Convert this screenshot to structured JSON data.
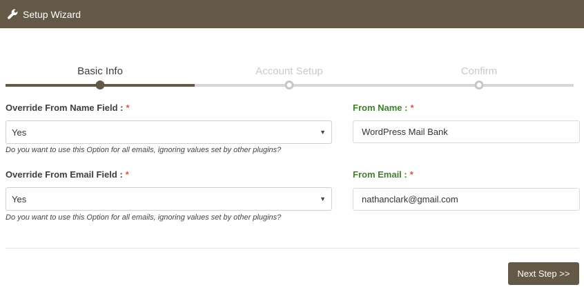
{
  "header": {
    "title": "Setup Wizard",
    "icon": "wrench-icon"
  },
  "wizard": {
    "steps": [
      {
        "label": "Basic Info",
        "state": "active"
      },
      {
        "label": "Account Setup",
        "state": "inactive"
      },
      {
        "label": "Confirm",
        "state": "inactive"
      }
    ]
  },
  "form": {
    "override_name": {
      "label": "Override From Name Field :",
      "required_mark": "*",
      "value": "Yes",
      "help": "Do you want to use this Option for all emails, ignoring values set by other plugins?"
    },
    "from_name": {
      "label": "From Name :",
      "required_mark": "*",
      "value": "WordPress Mail Bank"
    },
    "override_email": {
      "label": "Override From Email Field :",
      "required_mark": "*",
      "value": "Yes",
      "help": "Do you want to use this Option for all emails, ignoring values set by other plugins?"
    },
    "from_email": {
      "label": "From Email :",
      "required_mark": "*",
      "value": "nathanclark@gmail.com"
    }
  },
  "footer": {
    "next_label": "Next Step >>"
  },
  "colors": {
    "brand": "#645847",
    "accent_green": "#3f7f2b",
    "required_red": "#d9534f"
  }
}
